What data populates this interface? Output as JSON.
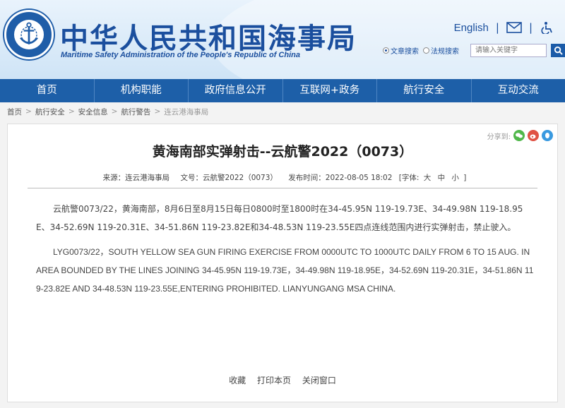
{
  "header": {
    "title_cn": "中华人民共和国海事局",
    "title_en": "Maritime Safety Administration of the People's Republic of China",
    "logo_text": "CHINA MSA",
    "lang_link": "English",
    "separator": "|",
    "search": {
      "option_article": "文章搜索",
      "option_law": "法规搜索",
      "placeholder": "请输入关键字"
    }
  },
  "nav": {
    "items": [
      {
        "label": "首页"
      },
      {
        "label": "机构职能"
      },
      {
        "label": "政府信息公开"
      },
      {
        "label": "互联网+政务"
      },
      {
        "label": "航行安全"
      },
      {
        "label": "互动交流"
      }
    ]
  },
  "breadcrumb": {
    "items": [
      "首页",
      "航行安全",
      "安全信息",
      "航行警告",
      "连云港海事局"
    ],
    "arrow": ">"
  },
  "article": {
    "share_label": "分享到:",
    "title": "黄海南部实弹射击--云航警2022（0073）",
    "meta": {
      "source": "来源：连云港海事局",
      "doc_no": "文号：云航警2022（0073）",
      "published": "发布时间：2022-08-05 18:02",
      "font_label": "[字体:",
      "size_large": "大",
      "size_medium": "中",
      "size_small": "小",
      "font_end": "]"
    },
    "para_cn": "云航警0073/22，黄海南部，8月6日至8月15日每日0800时至1800时在34-45.95N 119-19.73E、34-49.98N 119-18.95E、34-52.69N 119-20.31E、34-51.86N 119-23.82E和34-48.53N 119-23.55E四点连线范围内进行实弹射击，禁止驶入。",
    "para_en": "LYG0073/22，SOUTH YELLOW SEA GUN FIRING EXERCISE FROM 0000UTC TO 1000UTC DAILY FROM 6 TO 15 AUG. IN AREA BOUNDED BY THE LINES JOINING 34-45.95N 119-19.73E，34-49.98N 119-18.95E，34-52.69N 119-20.31E，34-51.86N 119-23.82E AND 34-48.53N 119-23.55E,ENTERING PROHIBITED. LIANYUNGANG MSA CHINA.",
    "footer": {
      "favorite": "收藏",
      "print": "打印本页",
      "close": "关闭窗口"
    }
  },
  "colors": {
    "brand_blue": "#1b4f9e",
    "nav_blue": "#1d5fa8",
    "wechat_green": "#51b84b",
    "weibo_red": "#e05244",
    "qq_blue": "#3a9ae0"
  }
}
